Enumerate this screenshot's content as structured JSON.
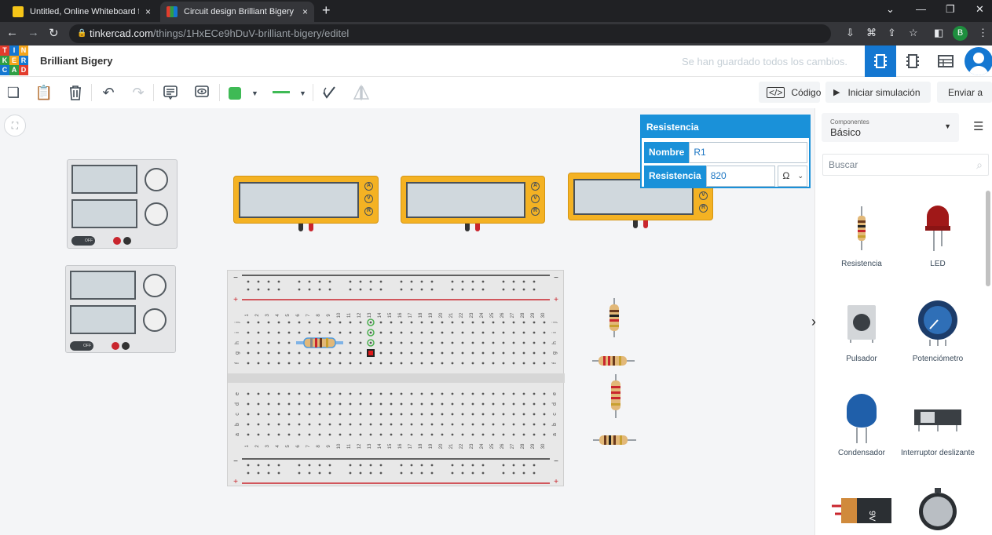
{
  "browser": {
    "tabs": [
      {
        "title": "Untitled, Online Whiteboard for \\",
        "close": "×"
      },
      {
        "title": "Circuit design Brilliant Bigery | Tir",
        "close": "×"
      }
    ],
    "new_tab": "+",
    "url_host": "tinkercad.com",
    "url_path": "/things/1HxECe9hDuV-brilliant-bigery/editel",
    "profile_initial": "B"
  },
  "app": {
    "logo_letters": [
      "T",
      "I",
      "N",
      "K",
      "E",
      "R",
      "C",
      "A",
      "D"
    ],
    "project_name": "Brilliant Bigery",
    "save_status": "Se han guardado todos los cambios."
  },
  "toolbar": {
    "code_label": "Código",
    "simulate_label": "Iniciar simulación",
    "send_label": "Enviar a"
  },
  "properties": {
    "title": "Resistencia",
    "name_label": "Nombre",
    "name_value": "R1",
    "resistance_label": "Resistencia",
    "resistance_value": "820",
    "unit": "Ω"
  },
  "breadboard": {
    "row_labels_top": [
      "j",
      "i",
      "h",
      "g",
      "f"
    ],
    "row_labels_bottom": [
      "e",
      "d",
      "c",
      "b",
      "a"
    ],
    "columns": 30
  },
  "meter_buttons": [
    "A",
    "V",
    "R"
  ],
  "psu_off_label": "OFF",
  "sidebar": {
    "components_label": "Componentes",
    "components_value": "Básico",
    "search_placeholder": "Buscar",
    "items": [
      {
        "label": "Resistencia"
      },
      {
        "label": "LED"
      },
      {
        "label": "Pulsador"
      },
      {
        "label": "Potenciómetro"
      },
      {
        "label": "Condensador"
      },
      {
        "label": "Interruptor deslizante"
      }
    ],
    "battery_label": "9V"
  },
  "colors": {
    "accent": "#1477d1",
    "meter": "#f4b223",
    "wire_green": "#3fba55"
  }
}
